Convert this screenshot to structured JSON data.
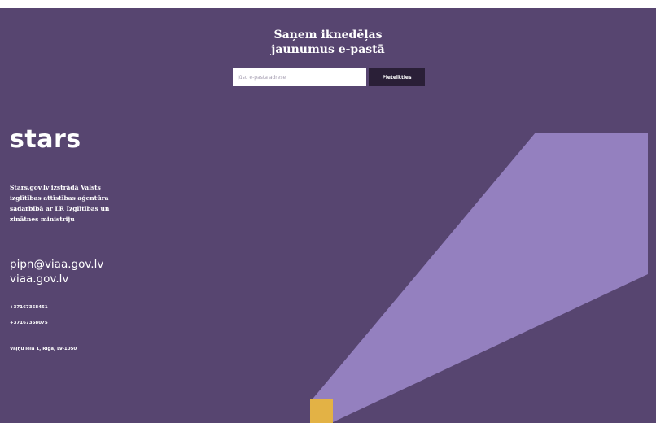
{
  "newsletter": {
    "title_line1": "Saņem iknedēļas",
    "title_line2": "jaunumus e-pastā",
    "email_placeholder": "Jūsu e-pasta adrese",
    "subscribe_label": "Pieteikties"
  },
  "footer": {
    "logo_text": "stars",
    "about_text": "Stars.gov.lv izstrādā Valsts izglītības attīstības aģentūra sadarbībā ar LR Izglītības un zinātnes ministriju",
    "email": "pipn@viaa.gov.lv",
    "website": "viaa.gov.lv",
    "phone_1": "+37167358451",
    "phone_2": "+37167358075",
    "address": "Vaļņu iela 1, Rīga, LV-1050"
  },
  "colors": {
    "background": "#574570",
    "light_purple_shape": "#9480bf",
    "accent_yellow": "#e3b245",
    "button_dark": "#2a1f37"
  }
}
